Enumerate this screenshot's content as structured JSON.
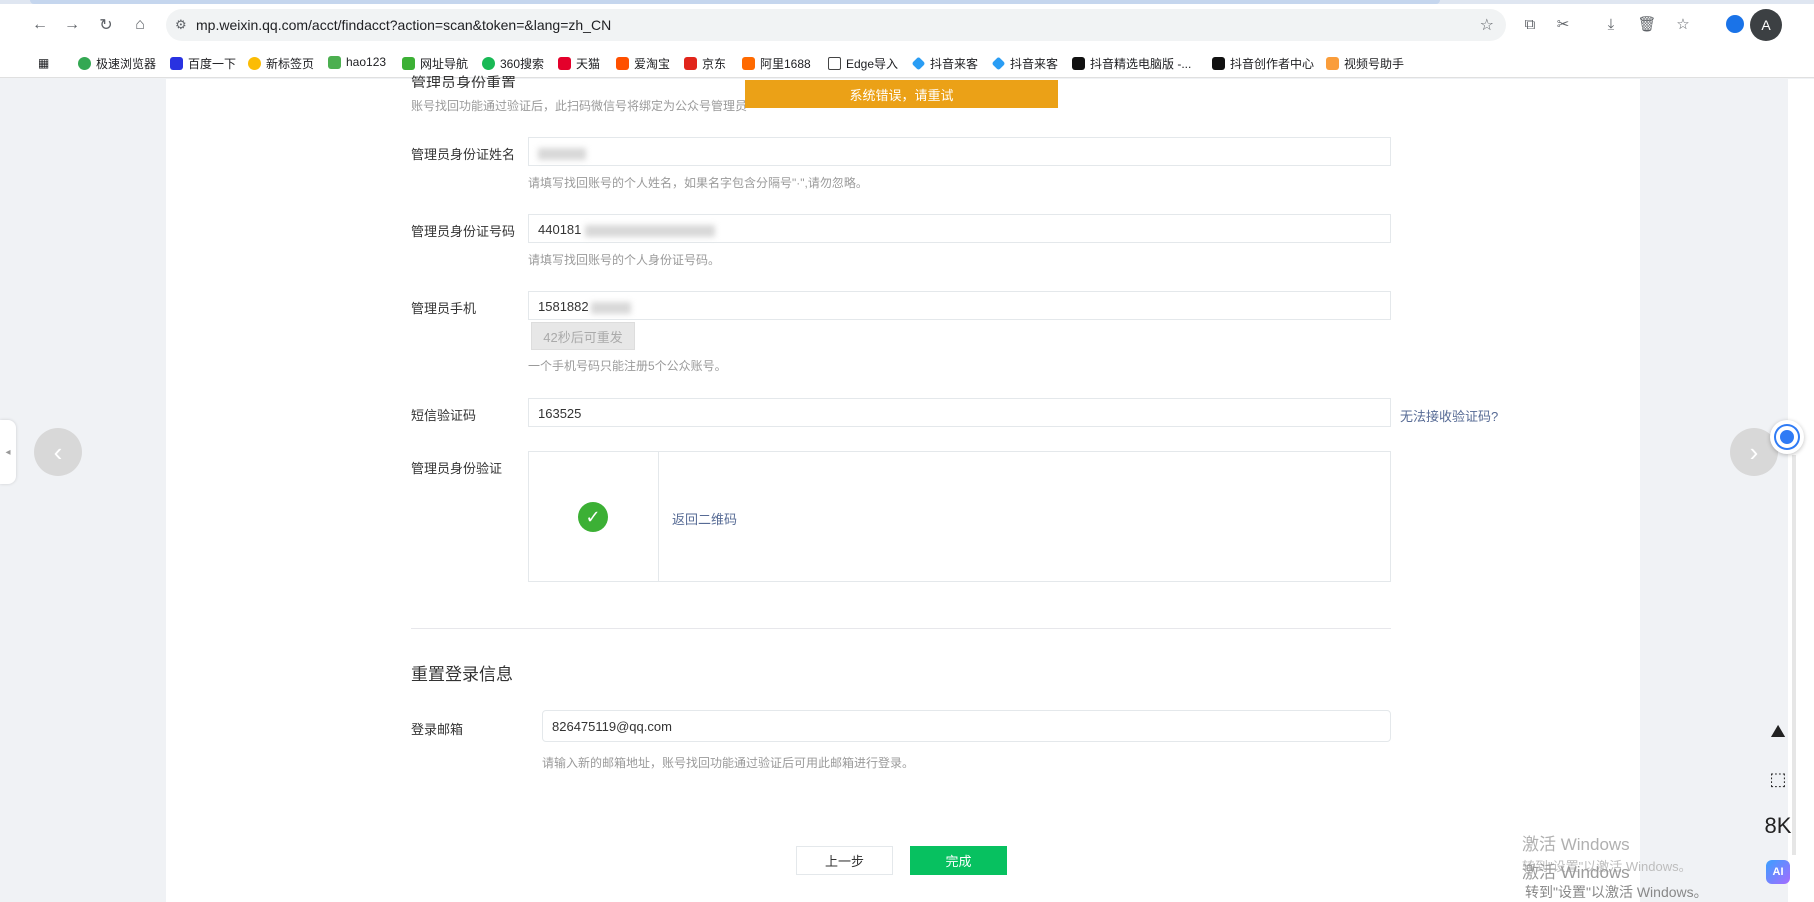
{
  "browser": {
    "url": "mp.weixin.qq.com/acct/findacct?action=scan&token=&lang=zh_CN",
    "avatar_text": "A"
  },
  "bookmarks": [
    {
      "label": "极速浏览器",
      "color": "#34a853"
    },
    {
      "label": "百度一下",
      "color": "#2932e1"
    },
    {
      "label": "新标签页",
      "color": "#fbbc05"
    },
    {
      "label": "hao123",
      "color": "#4caf50"
    },
    {
      "label": "网址导航",
      "color": "#3cb035"
    },
    {
      "label": "360搜索",
      "color": "#19b955"
    },
    {
      "label": "天猫",
      "color": "#e4002b"
    },
    {
      "label": "爱淘宝",
      "color": "#ff5000"
    },
    {
      "label": "京东",
      "color": "#e1251b"
    },
    {
      "label": "阿里1688",
      "color": "#ff6a00"
    },
    {
      "label": "Edge导入",
      "color": "#ffffff"
    },
    {
      "label": "抖音来客",
      "color": "#2a9df4"
    },
    {
      "label": "抖音来客",
      "color": "#2a9df4"
    },
    {
      "label": "抖音精选电脑版 -...",
      "color": "#111111"
    },
    {
      "label": "抖音创作者中心",
      "color": "#111111"
    },
    {
      "label": "视频号助手",
      "color": "#fa9d3b"
    }
  ],
  "toast": "系统错误，请重试",
  "section1": {
    "title": "管理员身份重置",
    "desc": "账号找回功能通过验证后，此扫码微信号将绑定为公众号管理员"
  },
  "fields": {
    "name_label": "管理员身份证姓名",
    "name_value": "",
    "name_hint": "请填写找回账号的个人姓名，如果名字包含分隔号\"·\",请勿忽略。",
    "id_label": "管理员身份证号码",
    "id_value": "440181",
    "id_hint": "请填写找回账号的个人身份证号码。",
    "phone_label": "管理员手机",
    "phone_value": "1581882",
    "resend_label": "42秒后可重发",
    "phone_hint": "一个手机号码只能注册5个公众账号。",
    "sms_label": "短信验证码",
    "sms_value": "163525",
    "sms_link": "无法接收验证码?",
    "verify_label": "管理员身份验证",
    "back_qr": "返回二维码"
  },
  "section2": {
    "title": "重置登录信息",
    "email_label": "登录邮箱",
    "email_value": "826475119@qq.com",
    "email_hint": "请输入新的邮箱地址，账号找回功能通过验证后可用此邮箱进行登录。"
  },
  "buttons": {
    "prev": "上一步",
    "done": "完成"
  },
  "side_tools": {
    "resolution": "8K",
    "ai": "AI"
  },
  "watermark": {
    "line1": "激活 Windows",
    "line2": "转到\"设置\"以激活 Windows。",
    "line3": "激活 Windows",
    "line4": "转到\"设置\"以激活 Windows。"
  },
  "colors": {
    "toast": "#eba117",
    "primary": "#07c160",
    "link": "#576b95",
    "check": "#3cb035"
  }
}
